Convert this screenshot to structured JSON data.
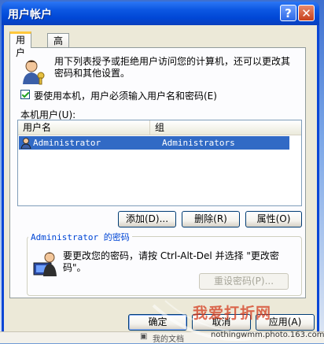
{
  "window": {
    "title": "用户帐户",
    "help_label": "?",
    "close_label": "✕"
  },
  "tabs": [
    {
      "label": "用户",
      "active": true
    },
    {
      "label": "高级",
      "active": false
    }
  ],
  "intro_text": "用下列表授予或拒绝用户访问您的计算机，还可以更改其密码和其他设置。",
  "require_login": {
    "label": "要使用本机，用户必须输入用户名和密码(E)",
    "checked": true
  },
  "local_users_label": "本机用户(U):",
  "users_table": {
    "columns": [
      "用户名",
      "组"
    ],
    "rows": [
      {
        "name": "Administrator",
        "group": "Administrators",
        "selected": true
      }
    ]
  },
  "user_buttons": {
    "add": "添加(D)...",
    "remove": "删除(R)",
    "properties": "属性(O)"
  },
  "password_group": {
    "title": "Administrator 的密码",
    "text": "要更改您的密码，请按 Ctrl-Alt-Del 并选择 \"更改密码\"。",
    "reset_button": "重设密码(P)..."
  },
  "dialog_buttons": {
    "ok": "确定",
    "cancel": "取消",
    "apply": "应用(A)"
  },
  "background": {
    "taskbar_item": "我的文档",
    "watermark_title": "我爱打折网",
    "watermark_url": "nothingwmm.photo.163.com"
  },
  "colors": {
    "title_bar": "#0047d5",
    "selection": "#316ac5",
    "group_title": "#0046d5",
    "active_tab_accent": "#ffc83c"
  }
}
